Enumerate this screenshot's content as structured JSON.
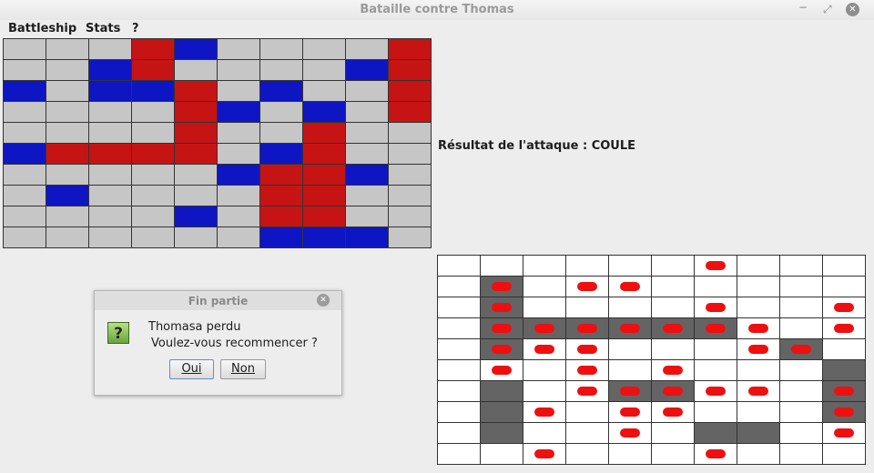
{
  "window": {
    "title": "Bataille contre Thomas",
    "minimize_glyph": "−",
    "maximize_glyph": "⤢",
    "close_glyph": "✕"
  },
  "menubar": {
    "items": [
      "Battleship",
      "Stats",
      "?"
    ]
  },
  "result_text": "Résultat de l'attaque : COULE",
  "own_board": {
    "legend": {
      "R": "#c61414",
      "B": "#0e16c4",
      "empty": "#c6c6c6"
    },
    "rows": [
      "...RB....R",
      "..BR....BR",
      "B.BBR.B..R",
      "....RB.B.R",
      "....R..R..",
      "BRRRR.BR..",
      ".....BRRB.",
      ".B....RR..",
      "....B.RR..",
      "......BBB."
    ]
  },
  "enemy_board": {
    "legend": {
      "S": "sunk",
      "o": "miss-peg",
      "X": "sunk-with-peg",
      "empty": "#ffffff"
    },
    "rows": [
      "......o...",
      ".X.oo.....",
      ".X....o..o",
      ".XXXXXXo.o",
      ".Xoo...oX",
      ".o.o.o...S",
      ".S.oXXoo.X",
      ".So.oo...X",
      ".S..o.SS.o",
      "..o...o..."
    ]
  },
  "dialog": {
    "title": "Fin partie",
    "close_glyph": "✕",
    "icon": "?",
    "line1": "Thomasa perdu",
    "line2": "Voulez-vous recommencer ?",
    "yes_label": "Oui",
    "no_label": "Non"
  }
}
